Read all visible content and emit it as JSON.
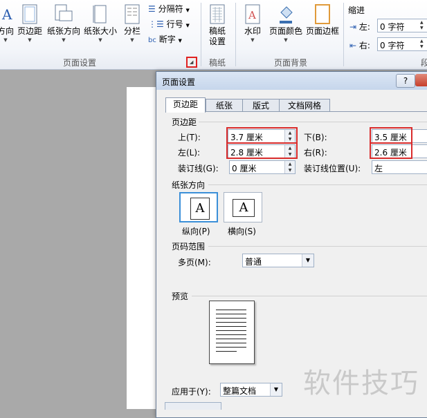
{
  "ribbon": {
    "page_setup_group": {
      "label": "页面设置",
      "buttons": [
        {
          "label": "方向"
        },
        {
          "label": "页边距"
        },
        {
          "label": "纸张方向"
        },
        {
          "label": "纸张大小"
        },
        {
          "label": "分栏"
        }
      ],
      "small": [
        {
          "label": "分隔符"
        },
        {
          "label": "行号"
        },
        {
          "label": "断字"
        }
      ]
    },
    "draft_group": {
      "label": "稿纸",
      "button_line1": "稿纸",
      "button_line2": "设置"
    },
    "background_group": {
      "label": "页面背景",
      "buttons": [
        {
          "label": "水印"
        },
        {
          "label": "页面颜色"
        },
        {
          "label": "页面边框"
        }
      ]
    },
    "indent_group": {
      "label": "缩进",
      "left_label": "左:",
      "left_value": "0 字符",
      "right_label": "右:",
      "right_value": "0 字符",
      "overflow_label": "段"
    }
  },
  "dialog": {
    "title": "页面设置",
    "help": "?",
    "tabs": [
      {
        "label": "页边距",
        "active": true
      },
      {
        "label": "纸张",
        "active": false
      },
      {
        "label": "版式",
        "active": false
      },
      {
        "label": "文档网格",
        "active": false
      }
    ],
    "margins": {
      "section": "页边距",
      "top_label": "上(T):",
      "top_value": "3.7 厘米",
      "bottom_label": "下(B):",
      "bottom_value": "3.5 厘米",
      "left_label": "左(L):",
      "left_value": "2.8 厘米",
      "right_label": "右(R):",
      "right_value": "2.6 厘米",
      "gutter_label": "装订线(G):",
      "gutter_value": "0 厘米",
      "gutter_pos_label": "装订线位置(U):",
      "gutter_pos_value": "左"
    },
    "orientation": {
      "section": "纸张方向",
      "portrait_label": "纵向(P)",
      "landscape_label": "横向(S)",
      "glyph": "A"
    },
    "pages": {
      "section": "页码范围",
      "multi_label": "多页(M):",
      "multi_value": "普通"
    },
    "preview": {
      "section": "预览",
      "apply_label": "应用于(Y):",
      "apply_value": "整篇文档"
    }
  },
  "watermark": "软件技巧",
  "colors": {
    "highlight": "#d92b2b",
    "selected_border": "#3a8fd8"
  }
}
